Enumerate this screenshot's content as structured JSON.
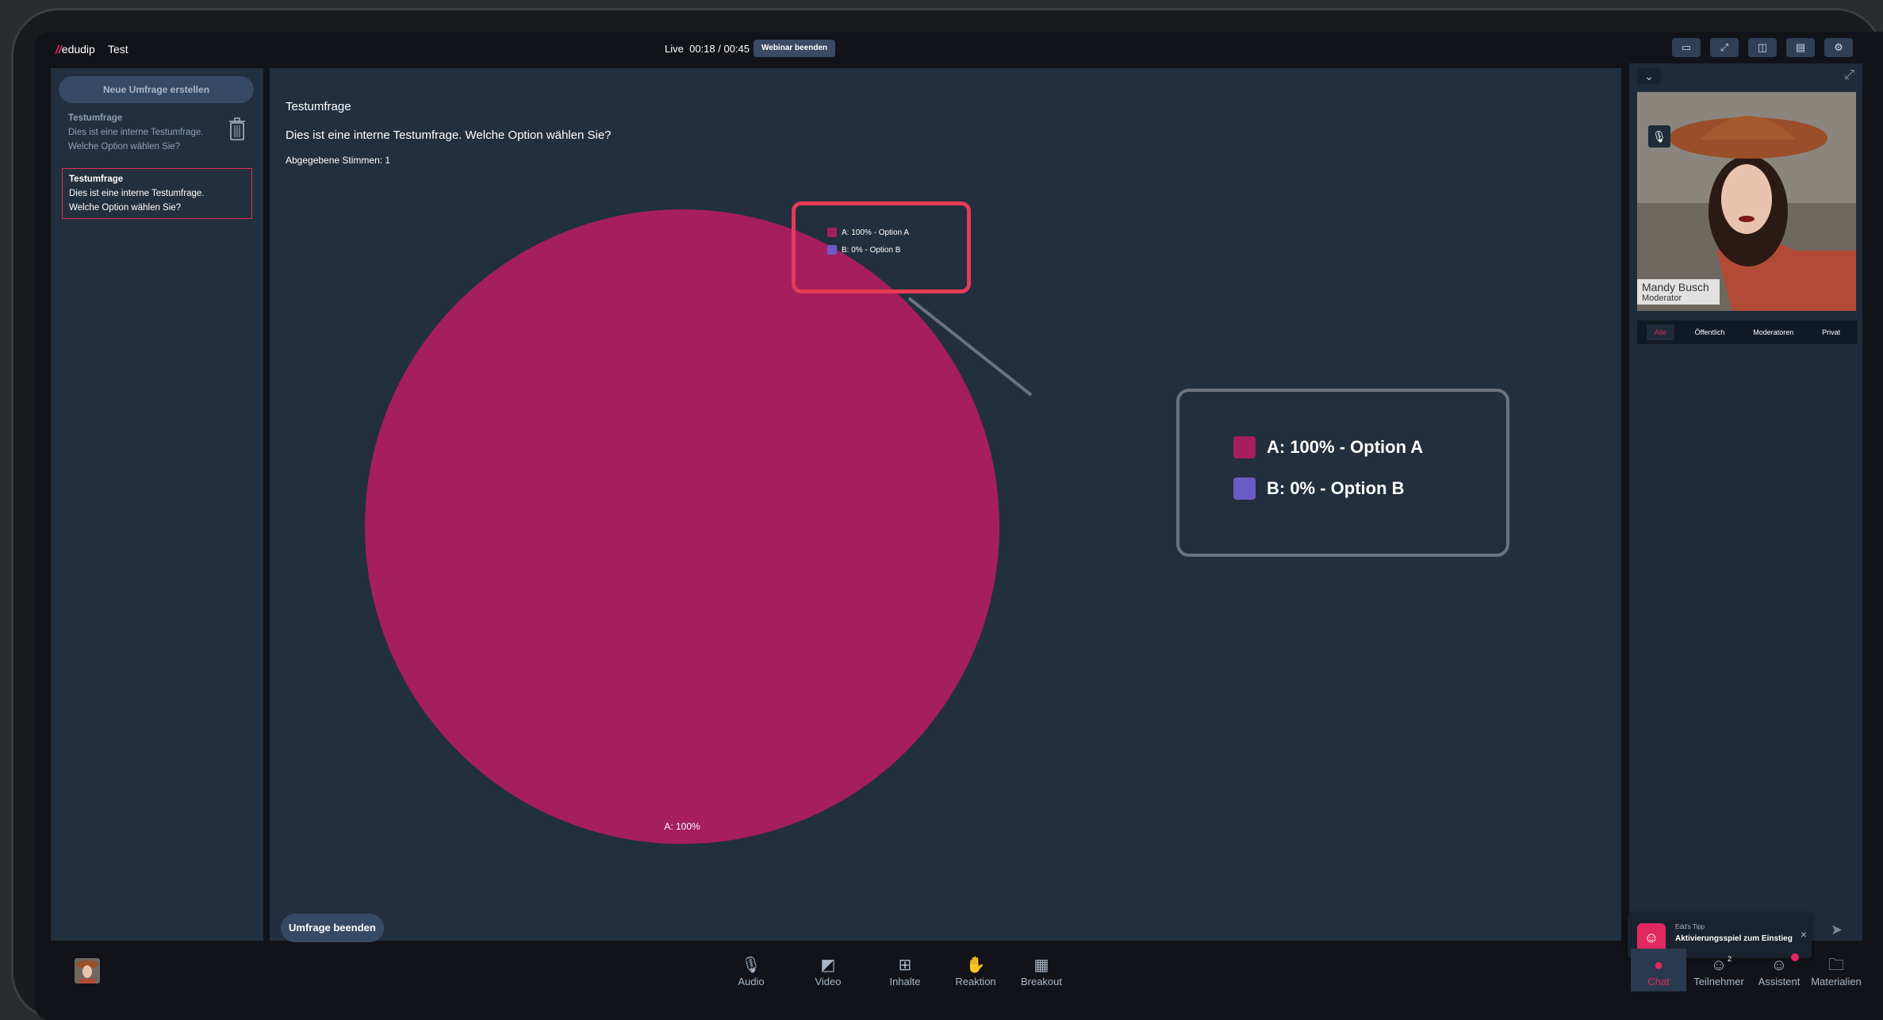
{
  "header": {
    "logo_mark": "//",
    "logo_brand": "edudip",
    "title": "Test",
    "live_label": "Live",
    "time": "00:18 / 00:45",
    "end_webinar": "Webinar beenden"
  },
  "sidebar": {
    "new_poll": "Neue Umfrage erstellen",
    "polls": [
      {
        "title": "Testumfrage",
        "text": "Dies ist eine interne Testumfrage. Welche Option wählen Sie?"
      },
      {
        "title": "Testumfrage",
        "text": "Dies ist eine interne Testumfrage. Welche Option wählen Sie?"
      }
    ]
  },
  "poll": {
    "title": "Testumfrage",
    "question": "Dies ist eine interne Testumfrage. Welche Option wählen Sie?",
    "votes": "Abgegebene Stimmen: 1",
    "end_button": "Umfrage beenden"
  },
  "chart_data": {
    "type": "pie",
    "categories": [
      "A",
      "B"
    ],
    "values": [
      100,
      0
    ],
    "slice_labels": [
      "A: 100%",
      ""
    ],
    "legend": [
      "A: 100% - Option A",
      "B: 0% - Option B"
    ],
    "colors": [
      "#a51e5e",
      "#6b5bc7"
    ],
    "legend_position": "top-right"
  },
  "right": {
    "participant_name": "Mandy Busch",
    "participant_role": "Moderator",
    "tabs": [
      "Alle",
      "Öffentlich",
      "Moderatoren",
      "Privat"
    ],
    "tip_small": "Edd's Tipp",
    "tip_main": "Aktivierungsspiel zum Einstieg"
  },
  "bottom": {
    "center": [
      "Audio",
      "Video",
      "Inhalte",
      "Reaktion",
      "Breakout"
    ],
    "right": [
      "Chat",
      "Teilnehmer",
      "Assistent",
      "Materialien"
    ],
    "participant_count": "2"
  },
  "colors": {
    "accent": "#e0295f",
    "panel": "#222f3e",
    "optionA": "#a51e5e",
    "optionB": "#6b5bc7"
  }
}
